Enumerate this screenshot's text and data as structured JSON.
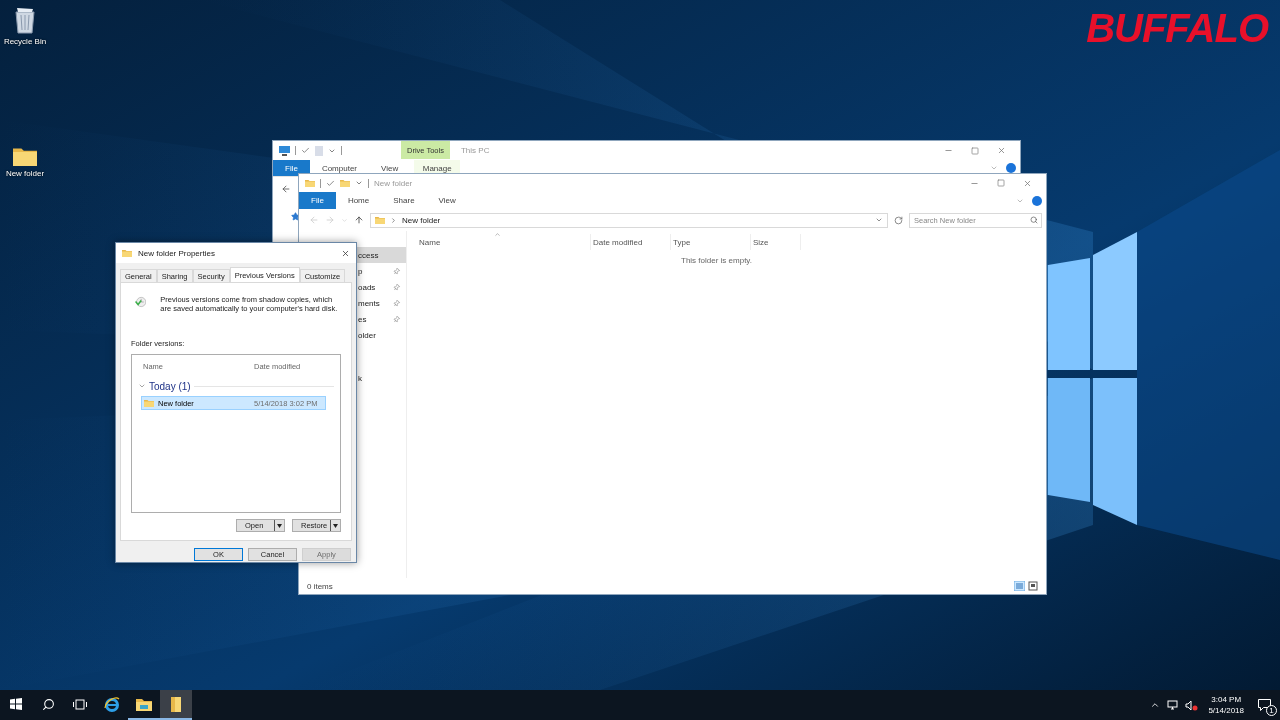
{
  "desktop": {
    "icons": [
      {
        "label": "Recycle Bin",
        "kind": "recycle"
      },
      {
        "label": "New folder",
        "kind": "folder"
      }
    ],
    "logo": "BUFFALO"
  },
  "back_window": {
    "title": "This PC",
    "context_group": "Drive Tools",
    "tabs": [
      {
        "label": "File",
        "kind": "file"
      },
      {
        "label": "Computer",
        "kind": "tab"
      },
      {
        "label": "View",
        "kind": "tab"
      },
      {
        "label": "Manage",
        "kind": "context"
      }
    ]
  },
  "front_window": {
    "title": "New folder",
    "tabs": [
      {
        "label": "File",
        "kind": "file"
      },
      {
        "label": "Home",
        "kind": "tab"
      },
      {
        "label": "Share",
        "kind": "tab"
      },
      {
        "label": "View",
        "kind": "tab"
      }
    ],
    "address": "New folder",
    "search": {
      "placeholder": "Search New folder"
    },
    "nav_items": [
      {
        "label": "ccess",
        "pinned": false,
        "selected": true
      },
      {
        "label": "p",
        "pinned": true,
        "selected": false
      },
      {
        "label": "oads",
        "pinned": true,
        "selected": false
      },
      {
        "label": "ments",
        "pinned": true,
        "selected": false
      },
      {
        "label": "es",
        "pinned": true,
        "selected": false
      },
      {
        "label": "older",
        "pinned": false,
        "selected": false
      },
      {
        "label": "k",
        "pinned": false,
        "selected": false
      }
    ],
    "columns": [
      "Name",
      "Date modified",
      "Type",
      "Size"
    ],
    "empty_message": "This folder is empty.",
    "status": "0 items"
  },
  "dialog": {
    "title": "New folder Properties",
    "tabs": [
      {
        "label": "General",
        "selected": false
      },
      {
        "label": "Sharing",
        "selected": false
      },
      {
        "label": "Security",
        "selected": false
      },
      {
        "label": "Previous Versions",
        "selected": true
      },
      {
        "label": "Customize",
        "selected": false
      }
    ],
    "description": "Previous versions come from shadow copies, which are saved automatically to your computer's hard disk.",
    "list_label": "Folder versions:",
    "columns": [
      "Name",
      "Date modified"
    ],
    "groups": [
      {
        "label": "Today (1)",
        "expanded": true,
        "rows": [
          {
            "name": "New folder",
            "date": "5/14/2018 3:02 PM",
            "selected": true
          }
        ]
      }
    ],
    "actions": [
      "Open",
      "Restore"
    ],
    "buttons": [
      {
        "label": "OK",
        "default": true,
        "disabled": false
      },
      {
        "label": "Cancel",
        "default": false,
        "disabled": false
      },
      {
        "label": "Apply",
        "default": false,
        "disabled": true
      }
    ]
  },
  "taskbar": {
    "apps": [
      {
        "kind": "start",
        "running": false,
        "active": false
      },
      {
        "kind": "search",
        "running": false,
        "active": false
      },
      {
        "kind": "taskview",
        "running": false,
        "active": false
      },
      {
        "kind": "browser",
        "running": false,
        "active": false
      },
      {
        "kind": "explorer",
        "running": true,
        "active": false
      },
      {
        "kind": "folder",
        "running": true,
        "active": true
      }
    ],
    "time": "3:04 PM",
    "date": "5/14/2018",
    "notifications": "1"
  }
}
